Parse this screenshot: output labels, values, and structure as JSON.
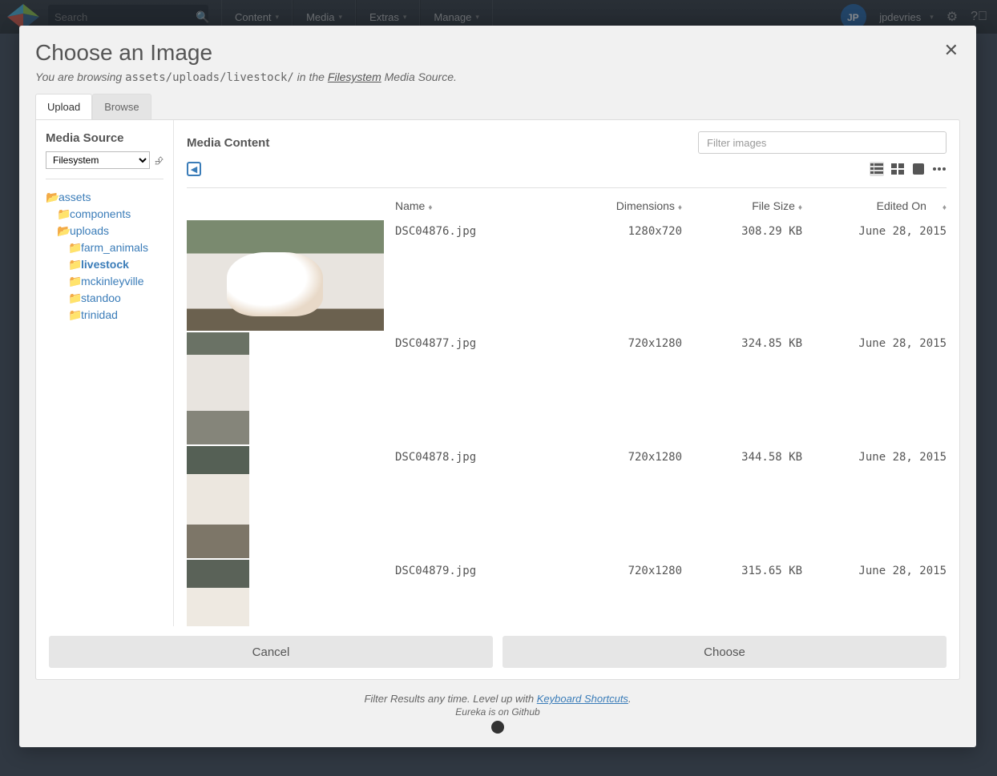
{
  "topnav": {
    "search_placeholder": "Search",
    "items": [
      "Content",
      "Media",
      "Extras",
      "Manage"
    ],
    "username": "jpdevries"
  },
  "modal": {
    "title": "Choose an Image",
    "subtitle_prefix": "You are browsing ",
    "subtitle_path": "assets/uploads/livestock/",
    "subtitle_middle": " in the ",
    "subtitle_link": "Filesystem",
    "subtitle_suffix": " Media Source.",
    "tabs": {
      "upload": "Upload",
      "browse": "Browse"
    },
    "sidebar": {
      "heading": "Media Source",
      "select_value": "Filesystem",
      "tree": {
        "root": "assets",
        "lvl1": [
          {
            "label": "components",
            "children": []
          },
          {
            "label": "uploads",
            "children": [
              {
                "label": "farm_animals",
                "active": false
              },
              {
                "label": "livestock",
                "active": true
              },
              {
                "label": "mckinleyville",
                "active": false
              },
              {
                "label": "standoo",
                "active": false
              },
              {
                "label": "trinidad",
                "active": false
              }
            ]
          }
        ]
      }
    },
    "content": {
      "heading": "Media Content",
      "filter_placeholder": "Filter images",
      "columns": {
        "name": "Name",
        "dimensions": "Dimensions",
        "filesize": "File Size",
        "edited": "Edited On"
      },
      "rows": [
        {
          "name": "DSC04876.jpg",
          "dimensions": "1280x720",
          "filesize": "308.29 KB",
          "edited": "June 28, 2015",
          "orient": "landscape",
          "thumb": "goat1"
        },
        {
          "name": "DSC04877.jpg",
          "dimensions": "720x1280",
          "filesize": "324.85 KB",
          "edited": "June 28, 2015",
          "orient": "portrait",
          "thumb": "goat2"
        },
        {
          "name": "DSC04878.jpg",
          "dimensions": "720x1280",
          "filesize": "344.58 KB",
          "edited": "June 28, 2015",
          "orient": "portrait",
          "thumb": "goat3"
        },
        {
          "name": "DSC04879.jpg",
          "dimensions": "720x1280",
          "filesize": "315.65 KB",
          "edited": "June 28, 2015",
          "orient": "portrait",
          "thumb": "goat4"
        }
      ]
    },
    "buttons": {
      "cancel": "Cancel",
      "choose": "Choose"
    },
    "credits": {
      "line1_a": "Filter Results any time. Level up with ",
      "line1_link": "Keyboard Shortcuts",
      "line1_b": ".",
      "line2": "Eureka is on Github"
    }
  }
}
